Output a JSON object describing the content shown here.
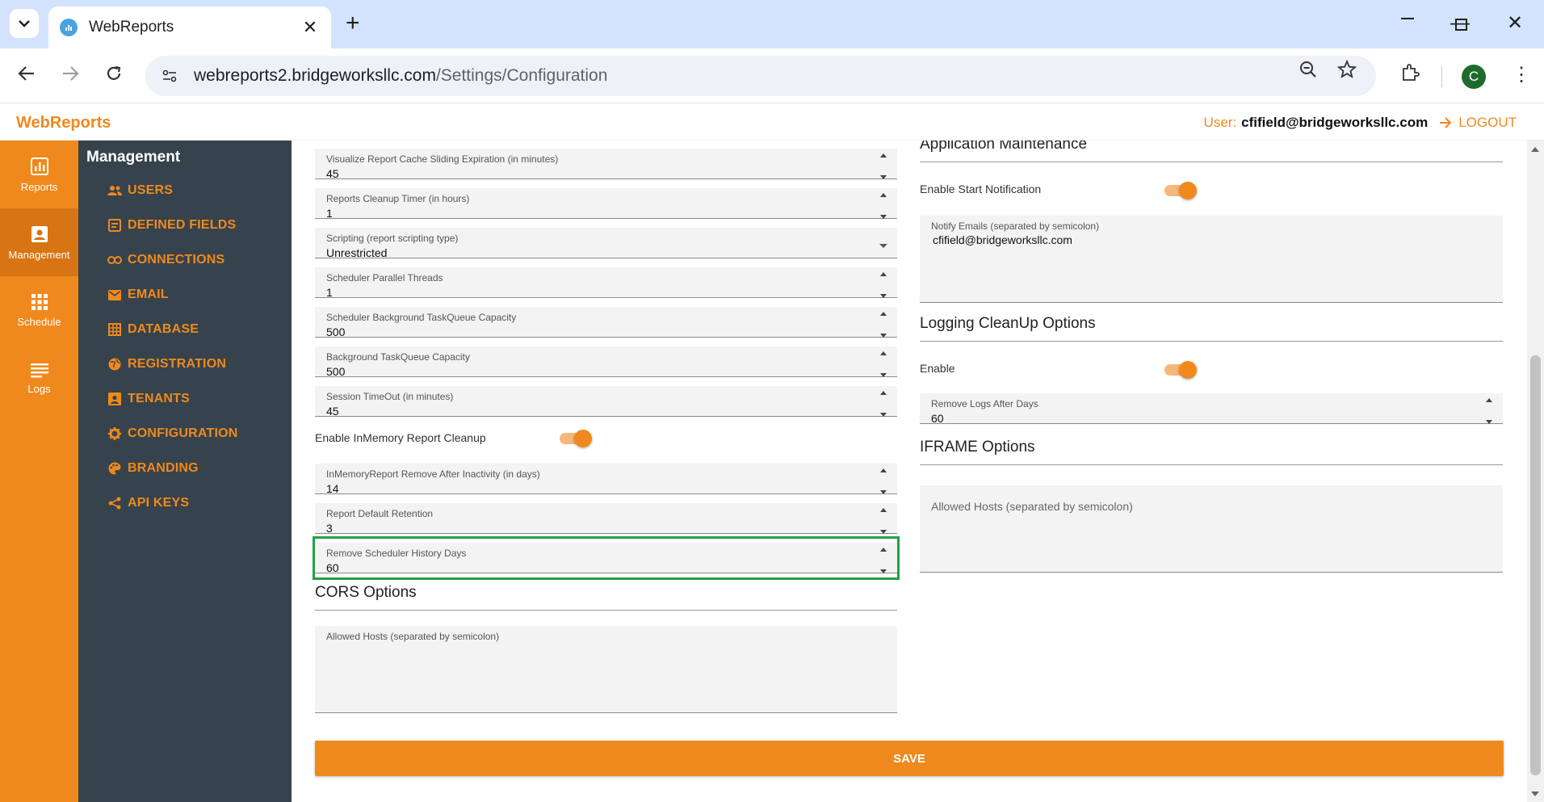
{
  "browser": {
    "tab_title": "WebReports",
    "url_host": "webreports2.bridgeworksllc.com",
    "url_path": "/Settings/Configuration",
    "profile_initial": "C"
  },
  "header": {
    "brand": "WebReports",
    "user_label": "User:",
    "user_email": "cfifield@bridgeworksllc.com",
    "logout_label": "LOGOUT"
  },
  "rail": {
    "items": [
      {
        "label": "Reports",
        "icon": "bar-chart-icon"
      },
      {
        "label": "Management",
        "icon": "account-box-icon",
        "active": true
      },
      {
        "label": "Schedule",
        "icon": "grid-icon"
      },
      {
        "label": "Logs",
        "icon": "list-icon"
      }
    ]
  },
  "management": {
    "title": "Management",
    "items": [
      {
        "label": "USERS",
        "icon": "people-icon"
      },
      {
        "label": "DEFINED FIELDS",
        "icon": "fields-icon"
      },
      {
        "label": "CONNECTIONS",
        "icon": "link-icon"
      },
      {
        "label": "EMAIL",
        "icon": "mail-icon"
      },
      {
        "label": "DATABASE",
        "icon": "database-grid-icon"
      },
      {
        "label": "REGISTRATION",
        "icon": "globe-icon"
      },
      {
        "label": "TENANTS",
        "icon": "tenant-icon"
      },
      {
        "label": "CONFIGURATION",
        "icon": "gear-icon"
      },
      {
        "label": "BRANDING",
        "icon": "palette-icon"
      },
      {
        "label": "API KEYS",
        "icon": "share-icon"
      }
    ]
  },
  "left_form": {
    "fields": [
      {
        "label": "Visualize Report Cache Sliding Expiration (in minutes)",
        "value": "45"
      },
      {
        "label": "Reports Cleanup Timer (in hours)",
        "value": "1"
      },
      {
        "label": "Scripting (report scripting type)",
        "value": "Unrestricted"
      },
      {
        "label": "Scheduler Parallel Threads",
        "value": "1"
      },
      {
        "label": "Scheduler Background TaskQueue Capacity",
        "value": "500"
      },
      {
        "label": "Background TaskQueue Capacity",
        "value": "500"
      },
      {
        "label": "Session TimeOut (in minutes)",
        "value": "45"
      },
      {
        "label": "InMemoryReport Remove After Inactivity (in days)",
        "value": "14"
      },
      {
        "label": "Report Default Retention",
        "value": "3"
      },
      {
        "label": "Remove Scheduler History Days",
        "value": "60"
      }
    ],
    "inmemory_toggle_label": "Enable InMemory Report Cleanup",
    "inmemory_toggle_on": true,
    "cors_title": "CORS Options",
    "cors_hosts_label": "Allowed Hosts (separated by semicolon)",
    "cors_hosts_value": ""
  },
  "right_form": {
    "app_maintenance_title": "Application Maintenance",
    "start_notification_label": "Enable Start Notification",
    "start_notification_on": true,
    "notify_emails_label": "Notify Emails (separated by semicolon)",
    "notify_emails_value": "cfifield@bridgeworksllc.com",
    "logging_title": "Logging CleanUp Options",
    "logging_enable_label": "Enable",
    "logging_enable_on": true,
    "remove_logs_label": "Remove Logs After Days",
    "remove_logs_value": "60",
    "iframe_title": "IFRAME Options",
    "iframe_hosts_placeholder": "Allowed Hosts (separated by semicolon)"
  },
  "save_label": "SAVE",
  "colors": {
    "accent": "#f0891d",
    "sidebar_dark": "#36434c",
    "highlight": "#22a045"
  }
}
